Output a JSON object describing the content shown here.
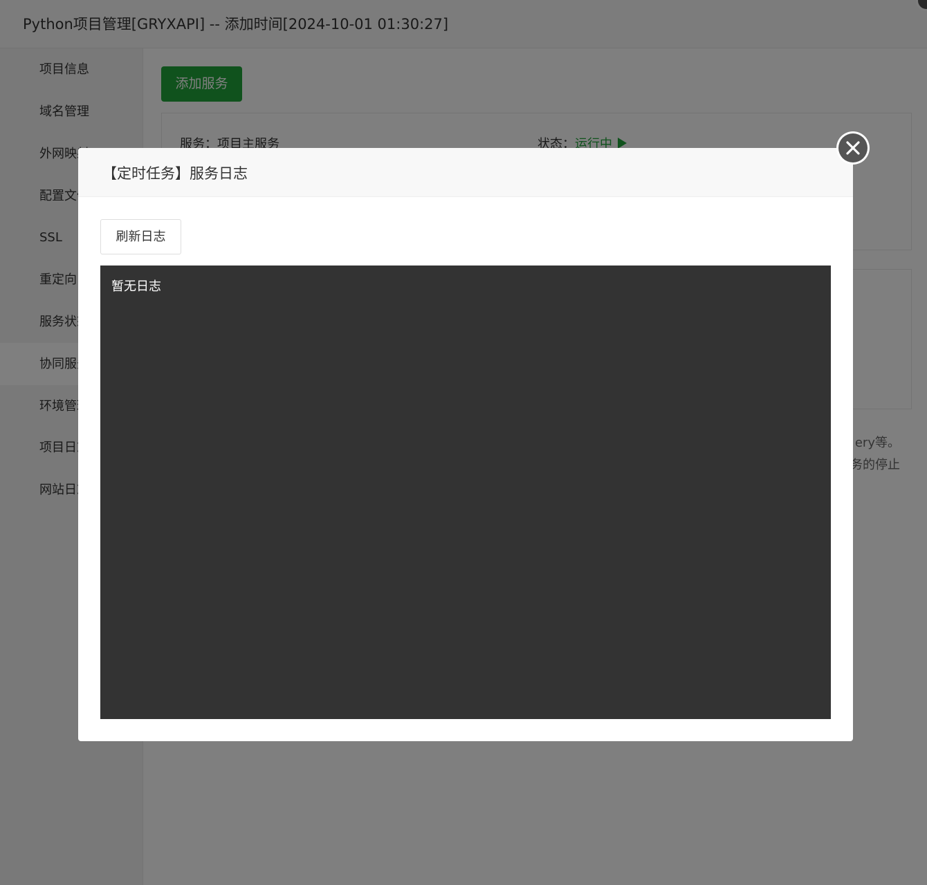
{
  "window": {
    "title": "Python项目管理[GRYXAPI] -- 添加时间[2024-10-01 01:30:27]"
  },
  "sidebar": {
    "items": [
      {
        "label": "项目信息"
      },
      {
        "label": "域名管理"
      },
      {
        "label": "外网映射"
      },
      {
        "label": "配置文件"
      },
      {
        "label": "SSL"
      },
      {
        "label": "重定向"
      },
      {
        "label": "服务状态"
      },
      {
        "label": "协同服务"
      },
      {
        "label": "环境管理"
      },
      {
        "label": "项目日志"
      },
      {
        "label": "网站日志"
      }
    ],
    "active_index": 7
  },
  "main": {
    "add_service_label": "添加服务",
    "service": {
      "name": "服务：项目主服务",
      "status_label": "状态：",
      "status_value": "运行中"
    },
    "tip_line1": "ery等。",
    "tip_line2": "务的停止"
  },
  "modal": {
    "title": "【定时任务】服务日志",
    "refresh_label": "刷新日志",
    "log_text": "暂无日志"
  },
  "colors": {
    "accent": "#20a53a",
    "log_bg": "#333333"
  }
}
